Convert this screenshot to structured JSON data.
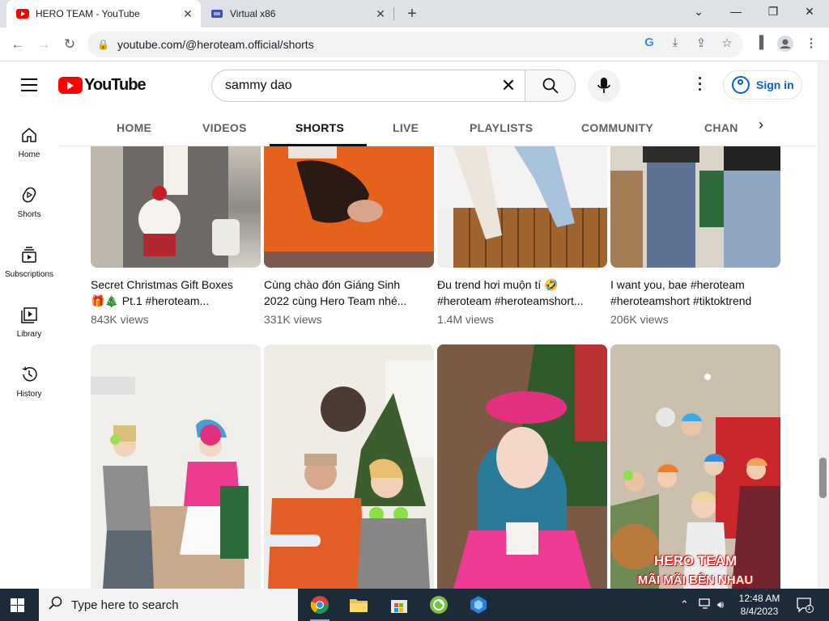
{
  "browser": {
    "tabs": [
      {
        "title": "HERO TEAM - YouTube",
        "active": true
      },
      {
        "title": "Virtual x86",
        "active": false
      }
    ],
    "url": "youtube.com/@heroteam.official/shorts"
  },
  "youtube": {
    "logo_text": "YouTube",
    "search_value": "sammy dao",
    "sign_in_label": "Sign in",
    "guide": [
      {
        "label": "Home"
      },
      {
        "label": "Shorts"
      },
      {
        "label": "Subscriptions"
      },
      {
        "label": "Library"
      },
      {
        "label": "History"
      }
    ],
    "channel_tabs": [
      "HOME",
      "VIDEOS",
      "SHORTS",
      "LIVE",
      "PLAYLISTS",
      "COMMUNITY",
      "CHANNELS"
    ],
    "selected_tab": "SHORTS",
    "shorts_row1": [
      {
        "title_line1": "Secret Christmas Gift Boxes",
        "title_line2": "🎁🎄 Pt.1 #heroteam...",
        "views": "843K views"
      },
      {
        "title_line1": "Cùng chào đón Giáng Sinh",
        "title_line2": "2022 cùng Hero Team nhé...",
        "views": "331K views"
      },
      {
        "title_line1": "Đu trend hơi muộn tí 🤣",
        "title_line2": "#heroteam #heroteamshort...",
        "views": "1.4M views"
      },
      {
        "title_line1": "I want you, bae #heroteam",
        "title_line2": "#heroteamshort #tiktoktrend",
        "views": "206K views"
      }
    ],
    "overlay": {
      "line1": "HERO TEAM",
      "line2": "MÃI MÃI BÊN NHAU"
    }
  },
  "taskbar": {
    "search_placeholder": "Type here to search",
    "time": "12:48 AM",
    "date": "8/4/2023",
    "notification_count": "1"
  },
  "colors": {
    "youtube_red": "#ff0000",
    "link_blue": "#065fd4",
    "taskbar": "#1c2a3a"
  }
}
